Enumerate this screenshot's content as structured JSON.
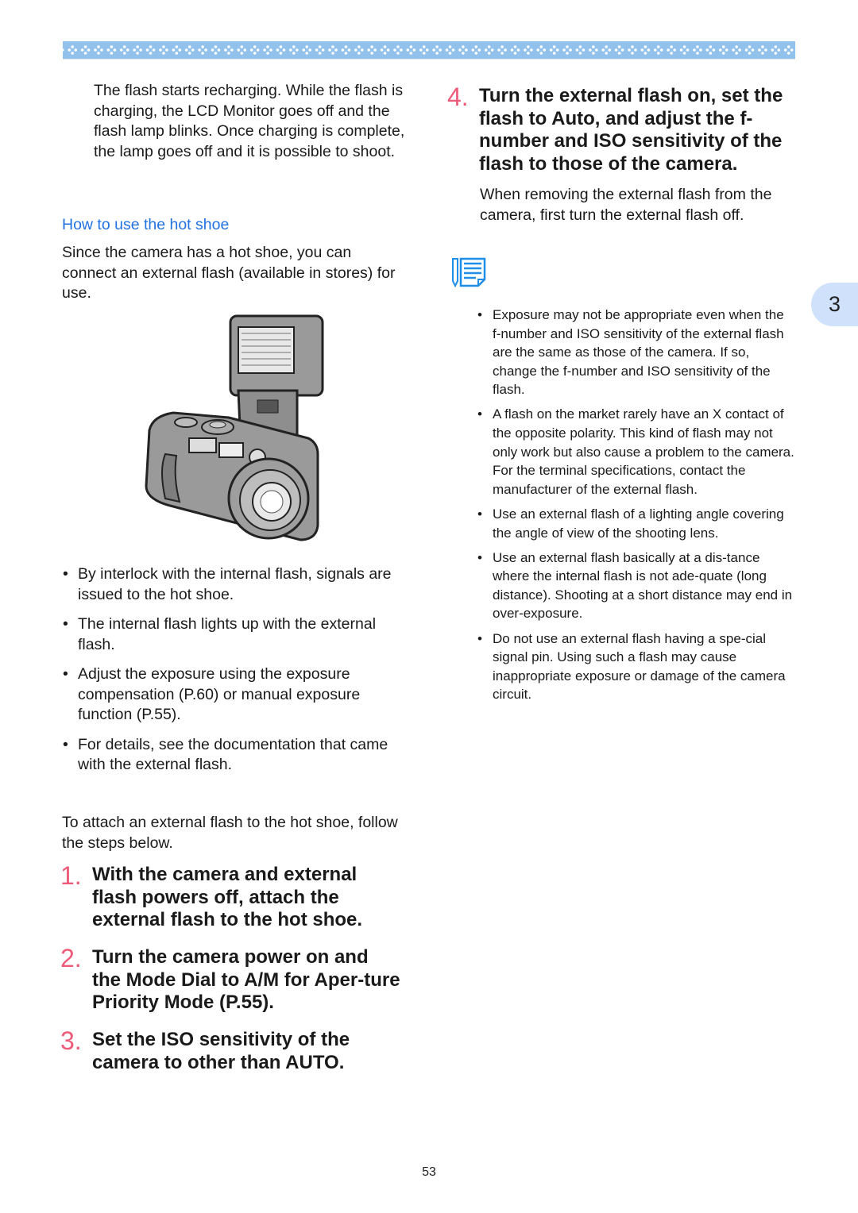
{
  "header": {
    "banner_pattern": "diamond-dot-border",
    "banner_color": "#92c2ec"
  },
  "left": {
    "intro_paragraph": "The flash starts recharging. While the flash is charging, the LCD Monitor goes off and the flash lamp blinks. Once charging is complete, the lamp goes off and it is possible to shoot.",
    "subheading": "How to use the hot shoe",
    "description": "Since the camera has a hot shoe, you can connect an external flash (available in stores) for use.",
    "illustration": "camera-with-external-flash-illustration",
    "bullets": [
      "By interlock with the internal flash, signals are issued to the hot shoe.",
      "The internal flash lights up with the external flash.",
      "Adjust the exposure using the exposure compensation (P.60) or manual exposure function (P.55).",
      "For details, see the documentation that came with the external flash."
    ],
    "steps_intro": "To attach an external flash to the hot shoe, follow the steps below.",
    "steps": [
      {
        "num": "1.",
        "text": "With the camera and external flash powers off, attach the external flash to the hot shoe."
      },
      {
        "num": "2.",
        "text": "Turn the camera power on and the Mode Dial to A/M for Aper-ture Priority Mode (P.55)."
      },
      {
        "num": "3.",
        "text": "Set the ISO sensitivity of the camera to other than AUTO."
      }
    ]
  },
  "right": {
    "step4": {
      "num": "4.",
      "text": "Turn the external flash on, set the flash to Auto, and adjust the f-number and ISO sensitivity of the flash to those of the camera."
    },
    "step4_note": "When removing the external flash from the camera, first turn the external flash off.",
    "note_icon": "memo-note-icon",
    "note_bullets": [
      "Exposure may not be appropriate even when the f-number and ISO sensitivity of the external flash are the same as those of the camera. If so, change the f-number and ISO sensitivity of the flash.",
      "A flash on the market rarely have an X contact of the opposite polarity. This kind of flash may not only work but also cause a problem to the camera. For the terminal specifications, contact the manufacturer of the external flash.",
      "Use an external flash of a lighting angle covering the angle of view of the shooting lens.",
      "Use an external flash basically at a dis-tance where the internal flash is not ade-quate (long distance). Shooting at a short distance may end in over-exposure.",
      "Do not use an external flash having a spe-cial signal pin. Using such a flash may cause inappropriate exposure or damage of the camera circuit."
    ]
  },
  "chapter_tab": "3",
  "page_number": "53",
  "colors": {
    "accent_blue": "#2272e0",
    "step_number_pink": "#ef5a7a",
    "tab_bg": "#cfe1fb"
  }
}
